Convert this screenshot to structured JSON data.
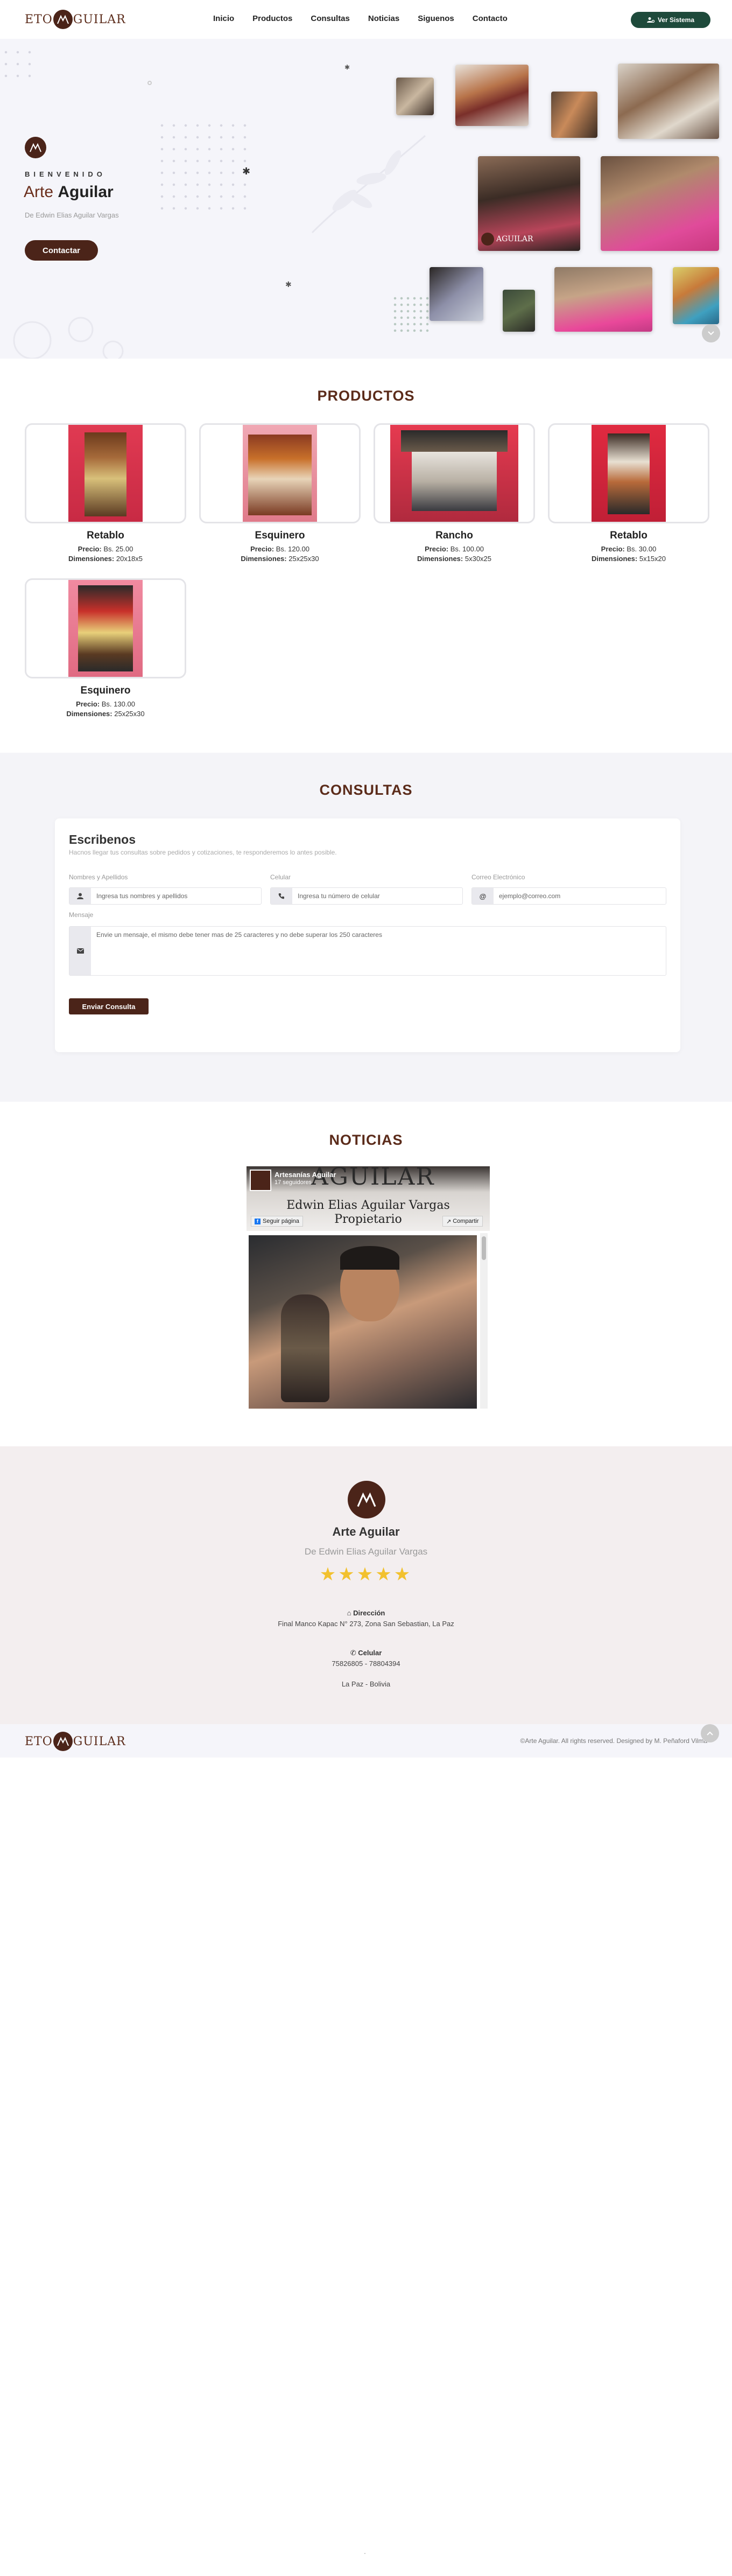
{
  "header": {
    "logo_text_left": "ETO",
    "logo_text_right": "GUILAR",
    "nav": [
      "Inicio",
      "Productos",
      "Consultas",
      "Noticias",
      "Siguenos",
      "Contacto"
    ],
    "system_button": "Ver Sistema",
    "system_icon": "users-cog-icon"
  },
  "hero": {
    "welcome": "BIENVENIDO",
    "title_first": "Arte",
    "title_second": "Aguilar",
    "subtitle": "De Edwin Elias Aguilar Vargas",
    "cta": "Contactar"
  },
  "productos": {
    "title": "PRODUCTOS",
    "price_label": "Precio:",
    "dim_label": "Dimensiones:",
    "items": [
      {
        "name": "Retablo",
        "price": "Bs. 25.00",
        "dims": "20x18x5"
      },
      {
        "name": "Esquinero",
        "price": "Bs. 120.00",
        "dims": "25x25x30"
      },
      {
        "name": "Rancho",
        "price": "Bs. 100.00",
        "dims": "5x30x25"
      },
      {
        "name": "Retablo",
        "price": "Bs. 30.00",
        "dims": "5x15x20"
      },
      {
        "name": "Esquinero",
        "price": "Bs. 130.00",
        "dims": "25x25x30"
      }
    ]
  },
  "consultas": {
    "title": "CONSULTAS",
    "form_title": "Escribenos",
    "form_desc": "Hacnos llegar tus consultas sobre pedidos y cotizaciones, te responderemos lo antes posible.",
    "fields": {
      "name_label": "Nombres y Apellidos",
      "name_placeholder": "Ingresa tus nombres y apellidos",
      "phone_label": "Celular",
      "phone_placeholder": "Ingresa tu número de celular",
      "email_label": "Correo Electrónico",
      "email_placeholder": "ejemplo@correo.com",
      "message_label": "Mensaje",
      "message_placeholder": "Envie un mensaje, el mismo debe tener mas de 25 caracteres y no debe superar los 250 caracteres"
    },
    "submit": "Enviar Consulta"
  },
  "noticias": {
    "title": "NOTICIAS",
    "fb_page_name": "Artesanías Aguilar",
    "fb_followers": "17 seguidores",
    "fb_follow": "Seguir página",
    "fb_share": "Compartir",
    "cover_line1": "Edwin Elias Aguilar Vargas",
    "cover_line2": "Propietario",
    "cover_brand": "AGUILAR"
  },
  "footer": {
    "brand": "Arte Aguilar",
    "subtitle": "De Edwin Elias Aguilar Vargas",
    "stars": 5,
    "address_label": "Dirección",
    "address": "Final Manco Kapac N° 273, Zona San Sebastian, La Paz",
    "phone_label": "Celular",
    "phones": "75826805 - 78804394",
    "city": "La Paz - Bolivia",
    "copyright": "©Arte Aguilar. All rights reserved. Designed by M. Peñaford Vilma",
    "bottom_logo_left": "ETO",
    "bottom_logo_right": "GUILAR",
    "misc_dot": "."
  },
  "colors": {
    "brand": "#4b2419",
    "accent_green": "#1e4a3b",
    "star": "#f2c12e"
  }
}
